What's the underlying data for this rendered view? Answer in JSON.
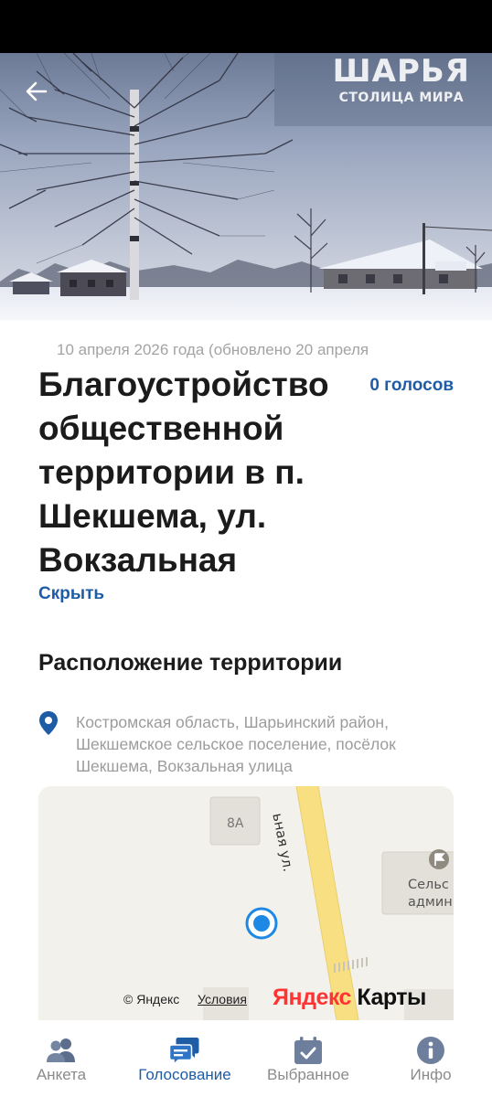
{
  "hero": {
    "watermark_line1": "ШАРЬЯ",
    "watermark_line2": "СТОЛИЦА МИРА",
    "back_icon": "arrow-left-icon"
  },
  "project": {
    "date_line": "10 апреля 2026 года (обновлено 20 апреля",
    "title": "Благоустройство общественной территории в п. Шекшема, ул. Вокзальная",
    "votes": "0 голосов",
    "hide_link": "Скрыть"
  },
  "location": {
    "section_title": "Расположение территории",
    "address": "Костромская область, Шарьинский район, Шекшемское сельское поселение, посёлок Шекшема, Вокзальная улица"
  },
  "map": {
    "street_label": "ьная ул.",
    "house_number": "8А",
    "poi_line1": "Сельс",
    "poi_line2": "админист",
    "copyright": "© Яндекс",
    "conditions": "Условия",
    "brand_part1": "Яндекс",
    "brand_part2": " Карты"
  },
  "bottom_nav": {
    "items": [
      {
        "label": "Анкета",
        "icon": "people-icon",
        "active": false
      },
      {
        "label": "Голосование",
        "icon": "chat-bubbles-icon",
        "active": true
      },
      {
        "label": "Выбранное",
        "icon": "calendar-check-icon",
        "active": false
      },
      {
        "label": "Инфо",
        "icon": "info-icon",
        "active": false
      }
    ]
  },
  "colors": {
    "accent": "#1f5ca6",
    "muted_text": "#9c9c9c",
    "map_road": "#f7df82",
    "map_pin": "#1e88e5"
  }
}
